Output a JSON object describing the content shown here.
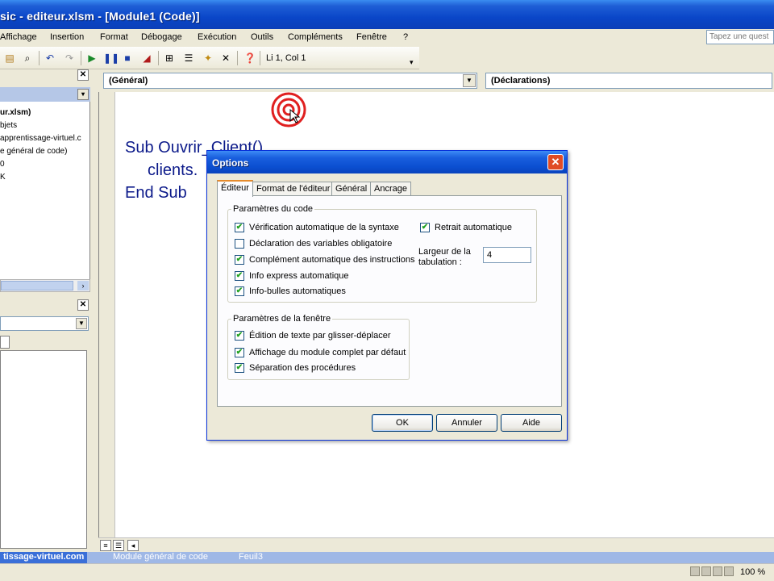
{
  "window": {
    "title": "sic - editeur.xlsm - [Module1 (Code)]"
  },
  "menu": {
    "items": [
      "Affichage",
      "Insertion",
      "Format",
      "Débogage",
      "Exécution",
      "Outils",
      "Compléments",
      "Fenêtre",
      "?"
    ],
    "help_placeholder": "Tapez une quest"
  },
  "toolbar": {
    "position": "Li 1, Col 1"
  },
  "project": {
    "tree": [
      "ur.xlsm)",
      "bjets",
      "apprentissage-virtuel.c",
      "e général de code)",
      "0",
      "K"
    ]
  },
  "code_window": {
    "object_combo": "(Général)",
    "proc_combo": "(Déclarations)",
    "lines": [
      "Sub Ouvrir_Client()",
      "clients.",
      "End Sub"
    ]
  },
  "bottom": {
    "tabs": [
      "tissage-virtuel.com",
      "Module général de code",
      "Feuil3"
    ],
    "zoom": "100 %"
  },
  "dialog": {
    "title": "Options",
    "tabs": [
      "Éditeur",
      "Format de l'éditeur",
      "Général",
      "Ancrage"
    ],
    "code_group": {
      "label": "Paramètres du code",
      "options": [
        {
          "label": "Vérification automatique de la syntaxe",
          "checked": true
        },
        {
          "label": "Déclaration des variables obligatoire",
          "checked": false
        },
        {
          "label": "Complément automatique des instructions",
          "checked": true
        },
        {
          "label": "Info express automatique",
          "checked": true
        },
        {
          "label": "Info-bulles automatiques",
          "checked": true
        }
      ],
      "auto_indent": {
        "label": "Retrait automatique",
        "checked": true
      },
      "tab_width_label_1": "Largeur de la",
      "tab_width_label_2": "tabulation :",
      "tab_width_value": "4"
    },
    "window_group": {
      "label": "Paramètres de la fenêtre",
      "options": [
        {
          "label": "Édition de texte par glisser-déplacer",
          "checked": true
        },
        {
          "label": "Affichage du module complet par défaut",
          "checked": true
        },
        {
          "label": "Séparation des procédures",
          "checked": true
        }
      ]
    },
    "buttons": {
      "ok": "OK",
      "cancel": "Annuler",
      "help": "Aide"
    }
  }
}
